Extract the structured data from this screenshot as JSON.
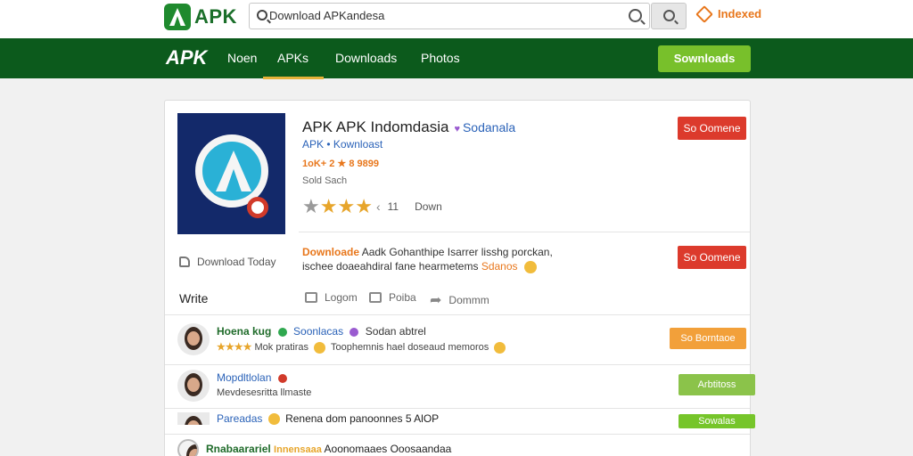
{
  "header": {
    "logo_text": "APK",
    "search_value": "Download APKandesa",
    "top_link": "Indexed"
  },
  "nav": {
    "logo": "APK",
    "items": [
      "Noen",
      "APKs",
      "Downloads",
      "Photos"
    ],
    "cta": "Sownloads"
  },
  "app": {
    "title": "APK APK Indomdasia",
    "developer": "Sodanala",
    "subtitle": "APK • Kownloast",
    "meta": "1oK+ 2 ★ 8 9899",
    "size": "Sold Sach",
    "rating_count": "11",
    "rating_label": "Down",
    "install_btn": "So Oomene",
    "download_btn": "So Oomene",
    "download_today": "Download Today",
    "desc_head": "Downloade",
    "desc_body": "Aadk Gohanthipe Isarrer lisshg porckan, ischee doaeahdiral fane hearmetems",
    "desc_more": "Sdanos"
  },
  "actions": {
    "write": "Write",
    "items": [
      "Logom",
      "Poiba",
      "Dommm"
    ]
  },
  "reviews": [
    {
      "name": "Hoena kug",
      "tag": "Soonlacas",
      "extra": "Sodan abtrel",
      "stars": "★★★★",
      "text": "Mok pratiras",
      "text2": "Toophemnis hael doseaud memoros",
      "button": "So Borntaoe",
      "button_color": "#f2a03a"
    },
    {
      "name": "Mopdltlolan",
      "text": "Mevdesesritta llmaste",
      "button": "Arbtitoss",
      "button_color": "#8bc34a"
    },
    {
      "name": "Pareadas",
      "text": "Renena dom panoonnes 5 AlOP",
      "button": "Sowalas",
      "button_color": "#76c52a"
    },
    {
      "name": "Rnabaarariel",
      "tag": "Innensaaa",
      "text": "Aoonomaaes Ooosaandaa"
    }
  ]
}
